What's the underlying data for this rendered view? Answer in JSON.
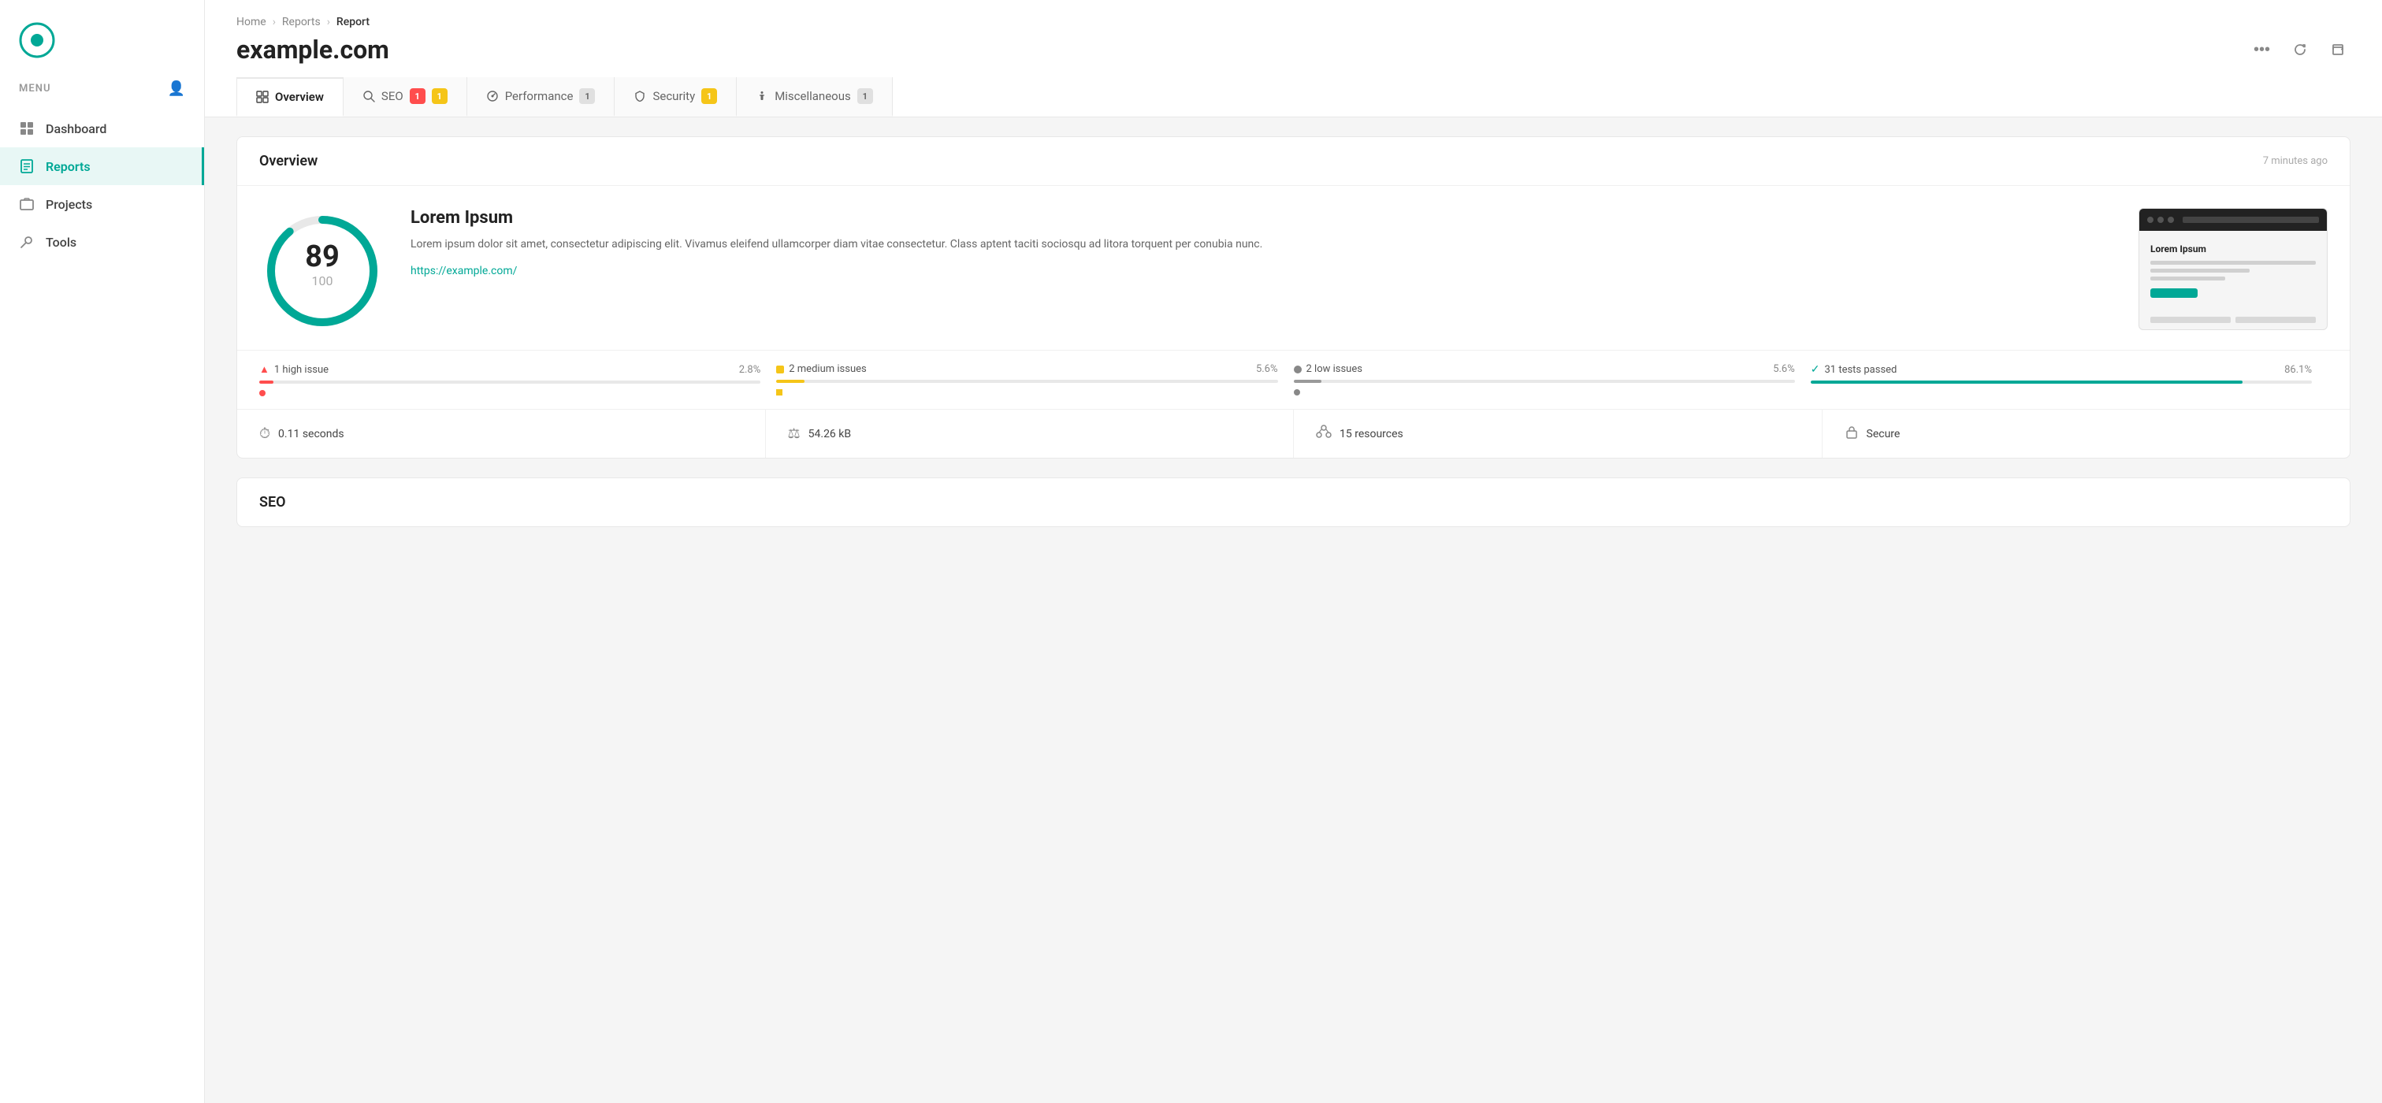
{
  "sidebar": {
    "menu_label": "MENU",
    "nav_items": [
      {
        "id": "dashboard",
        "label": "Dashboard",
        "active": false
      },
      {
        "id": "reports",
        "label": "Reports",
        "active": true
      },
      {
        "id": "projects",
        "label": "Projects",
        "active": false
      },
      {
        "id": "tools",
        "label": "Tools",
        "active": false
      }
    ]
  },
  "breadcrumb": {
    "home": "Home",
    "reports": "Reports",
    "current": "Report"
  },
  "page": {
    "title": "example.com"
  },
  "tabs": [
    {
      "id": "overview",
      "label": "Overview",
      "badge": null,
      "active": true
    },
    {
      "id": "seo",
      "label": "SEO",
      "badge_red": "1",
      "badge_yellow": "1",
      "active": false
    },
    {
      "id": "performance",
      "label": "Performance",
      "badge_gray": "1",
      "active": false
    },
    {
      "id": "security",
      "label": "Security",
      "badge_yellow": "1",
      "active": false
    },
    {
      "id": "miscellaneous",
      "label": "Miscellaneous",
      "badge_gray": "1",
      "active": false
    }
  ],
  "overview": {
    "section_title": "Overview",
    "timestamp": "7 minutes ago",
    "score_value": "89",
    "score_max": "100",
    "desc_title": "Lorem Ipsum",
    "desc_text": "Lorem ipsum dolor sit amet, consectetur adipiscing elit. Vivamus eleifend ullamcorper diam vitae consectetur. Class aptent taciti sociosqu ad litora torquent per conubia nunc.",
    "desc_link": "https://example.com/",
    "thumb_title": "Lorem Ipsum",
    "issues": [
      {
        "type": "high",
        "count": "1",
        "label": "1 high issue",
        "pct": "2.8%",
        "fill_width": "2.8",
        "color": "red"
      },
      {
        "type": "medium",
        "count": "2",
        "label": "2 medium issues",
        "pct": "5.6%",
        "fill_width": "5.6",
        "color": "yellow"
      },
      {
        "type": "low",
        "count": "2",
        "label": "2 low issues",
        "pct": "5.6%",
        "fill_width": "5.6",
        "color": "gray"
      },
      {
        "type": "passed",
        "count": "31",
        "label": "31 tests passed",
        "pct": "86.1%",
        "fill_width": "86.1",
        "color": "green"
      }
    ],
    "metrics": [
      {
        "icon": "⏱",
        "value": "0.11 seconds"
      },
      {
        "icon": "⚖",
        "value": "54.26 kB"
      },
      {
        "icon": "👥",
        "value": "15 resources"
      },
      {
        "icon": "🔒",
        "value": "Secure"
      }
    ]
  },
  "seo_section": {
    "title": "SEO"
  }
}
